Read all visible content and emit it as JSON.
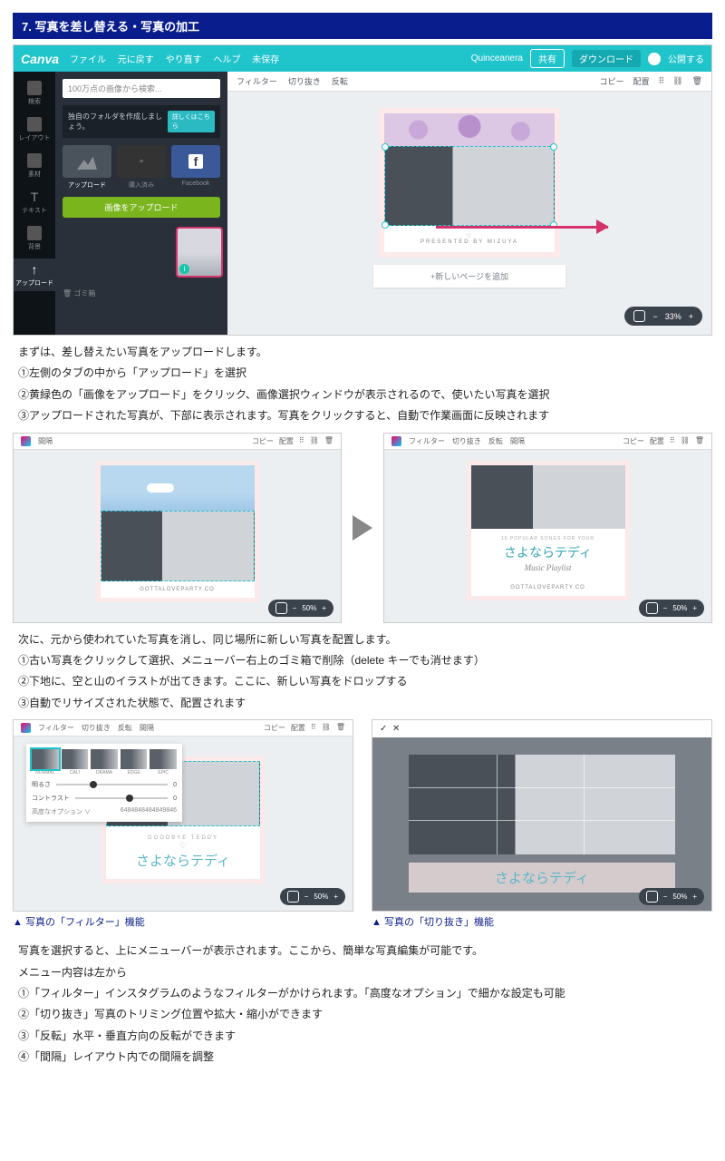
{
  "header": "7. 写真を差し替える・写真の加工",
  "canva": {
    "logo": "Canva",
    "menu": [
      "ファイル",
      "元に戻す",
      "やり直す",
      "ヘルプ",
      "未保存"
    ],
    "docTitle": "Quinceanera",
    "share": "共有",
    "download": "ダウンロード",
    "publish": "公開する",
    "side": [
      "検索",
      "レイアウト",
      "素材",
      "テキスト",
      "背景",
      "アップロード"
    ],
    "searchPlaceholder": "100万点の画像から検索...",
    "folderTip": "独自のフォルダを作成しましょう。",
    "folderBtn": "詳しくはこちら",
    "sources": [
      "アップロード",
      "購入済み",
      "Facebook"
    ],
    "uploadBtn": "画像をアップロード",
    "trash": "ゴミ箱",
    "tools": [
      "フィルター",
      "切り抜き",
      "反転"
    ],
    "rtools": [
      "コピー",
      "配置"
    ],
    "presented": "PRESENTED BY MIZUYA",
    "addPage": "+新しいページを追加",
    "zoom": "33%"
  },
  "txt1": {
    "l1": "まずは、差し替えたい写真をアップロードします。",
    "l2": "①左側のタブの中から「アップロード」を選択",
    "l3": "②黄緑色の「画像をアップロード」をクリック、画像選択ウィンドウが表示されるので、使いたい写真を選択",
    "l4": "③アップロードされた写真が、下部に表示されます。写真をクリックすると、自動で作業画面に反映されます"
  },
  "mini": {
    "tool_sel": "間隔",
    "copy": "コピー",
    "arrange": "配置",
    "popular": "10 POPULAR SONGS FOR YOUR",
    "jp_title": "さよならテディ",
    "en_title": "Music Playlist",
    "party": "GOTTALOVEPARTY.CO",
    "zoom50": "50%"
  },
  "txt2": {
    "l1": "次に、元から使われていた写真を消し、同じ場所に新しい写真を配置します。",
    "l2": "①古い写真をクリックして選択、メニューバー右上のゴミ箱で削除（delete キーでも消せます）",
    "l3": "②下地に、空と山のイラストが出てきます。ここに、新しい写真をドロップする",
    "l4": "③自動でリサイズされた状態で、配置されます"
  },
  "filter": {
    "tools": [
      "フィルター",
      "切り抜き",
      "反転",
      "間隔"
    ],
    "presets": [
      "NORMAL",
      "CALI",
      "DRAMA",
      "EDGE",
      "EPIC"
    ],
    "brightness": "明るさ",
    "contrast": "コントラスト",
    "advanced": "高度なオプション ∨",
    "code": "6484848484849846",
    "goodbye": "GOODBYE TEDDY",
    "jp_title": "さよならテディ"
  },
  "crop": {
    "ok": "✓",
    "cancel": "✕",
    "jp_title": "さよならテディ"
  },
  "cap": {
    "filter": "▲ 写真の「フィルター」機能",
    "crop": "▲ 写真の「切り抜き」機能"
  },
  "txt3": {
    "l1": "写真を選択すると、上にメニューバーが表示されます。ここから、簡単な写真編集が可能です。",
    "l2": "メニュー内容は左から",
    "l3": "①「フィルター」インスタグラムのようなフィルターがかけられます。「高度なオプション」で細かな設定も可能",
    "l4": "②「切り抜き」写真のトリミング位置や拡大・縮小ができます",
    "l5": "③「反転」水平・垂直方向の反転ができます",
    "l6": "④「間隔」レイアウト内での間隔を調整"
  }
}
